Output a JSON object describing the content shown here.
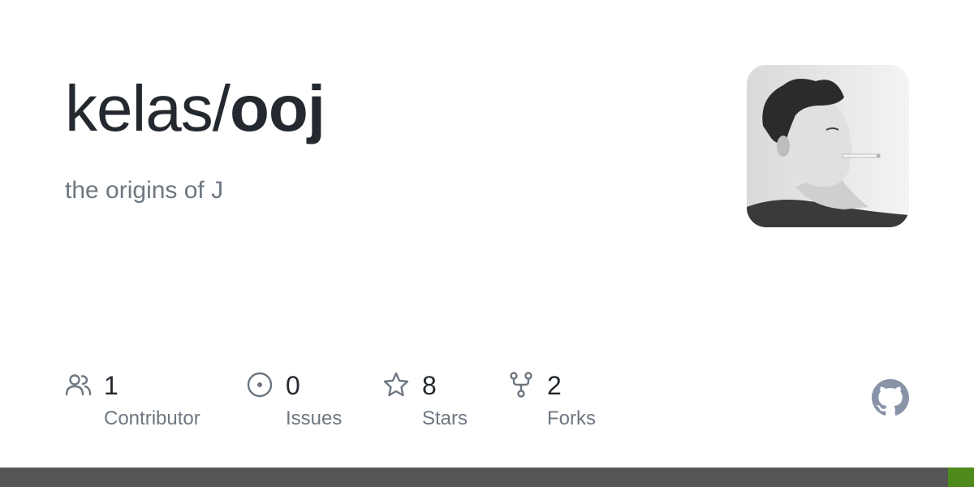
{
  "repo": {
    "owner": "kelas/",
    "name": "ooj",
    "description": "the origins of J"
  },
  "stats": [
    {
      "icon": "people-icon",
      "count": "1",
      "label": "Contributor"
    },
    {
      "icon": "issue-icon",
      "count": "0",
      "label": "Issues"
    },
    {
      "icon": "star-icon",
      "count": "8",
      "label": "Stars"
    },
    {
      "icon": "fork-icon",
      "count": "2",
      "label": "Forks"
    }
  ],
  "colors": {
    "title": "#24292f",
    "muted": "#6e7781",
    "bar": "#555555",
    "language": "#4d8a1a",
    "logo": "#8993a8"
  }
}
